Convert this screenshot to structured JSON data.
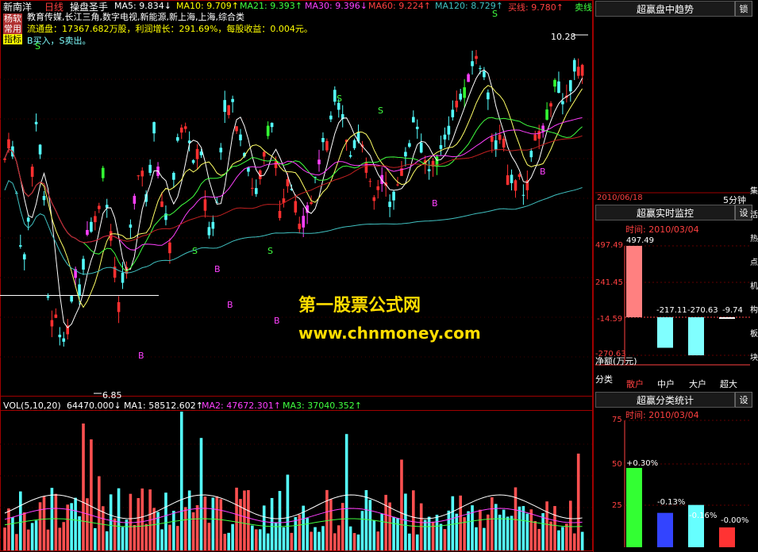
{
  "header": {
    "stock": "新南洋",
    "period": "日线",
    "indicator": "操盘圣手",
    "ma5": "MA5: 9.834↓",
    "ma10": "MA10: 9.709↑",
    "ma21": "MA21: 9.393↑",
    "ma30": "MA30: 9.396↓",
    "ma60": "MA60: 9.224↑",
    "ma120": "MA120: 8.729↑",
    "buyline": "买线: 9.780↑",
    "sellline": "卖线",
    "concepts": "教育传媒,长江三角,数字电视,新能源,新上海,上海,综合类",
    "info": "流通盘：17367.682万股，利润增长：291.69%，每股收益：0.004元。",
    "legend": "B买入，S卖出。"
  },
  "tags": {
    "t1": "杨软",
    "t2": "常用",
    "t3": "指标"
  },
  "price": {
    "high_label": "10.28",
    "low_label": "6.85"
  },
  "signals": [
    "S",
    "S",
    "S",
    "S",
    "S",
    "S",
    "B",
    "B",
    "B",
    "B",
    "B",
    "B"
  ],
  "volume": {
    "title": "VOL(5,10,20)",
    "value": "64470.000↓",
    "ma1": "MA1: 58512.602↑",
    "ma2": "MA2: 47672.301↑",
    "ma3": "MA3: 37040.352↑"
  },
  "watermark": {
    "line1": "第一股票公式网",
    "line2": "www.chnmoney.com"
  },
  "panel1": {
    "title": "超赢盘中趋势",
    "lock": "锁",
    "date": "2010/06/18",
    "interval": "5分钟"
  },
  "panel2": {
    "title": "超赢实时监控",
    "btn": "设",
    "time": "时间: 2010/03/04",
    "yaxis": [
      "497.49",
      "241.45",
      "-14.59",
      "-270.63"
    ],
    "ylabel": "净额(万元)",
    "xlabel": "分类",
    "categories": [
      "散户",
      "中户",
      "大户",
      "超大"
    ],
    "bar_labels": [
      "497.49",
      "-217.11",
      "-270.63",
      "-9.74"
    ],
    "values": [
      497.49,
      -217.11,
      -270.63,
      -9.74
    ],
    "colors": [
      "#ff8080",
      "#80ffff",
      "#80ffff",
      "#ffffff"
    ]
  },
  "panel3": {
    "title": "超赢分类统计",
    "btn": "设",
    "time": "时间: 2010/03/04",
    "yaxis": [
      "75",
      "50",
      "25"
    ],
    "bar_labels": [
      "+0.30%",
      "-0.13%",
      "-0.16%",
      "-0.00%"
    ],
    "values": [
      0.3,
      -0.13,
      -0.16,
      -0.0
    ],
    "colors": [
      "#33ff33",
      "#3344ff",
      "#66ffff",
      "#ff3333"
    ]
  },
  "right_edge": [
    "集",
    "活",
    "热",
    "点",
    "机",
    "构",
    "板",
    "块"
  ]
}
